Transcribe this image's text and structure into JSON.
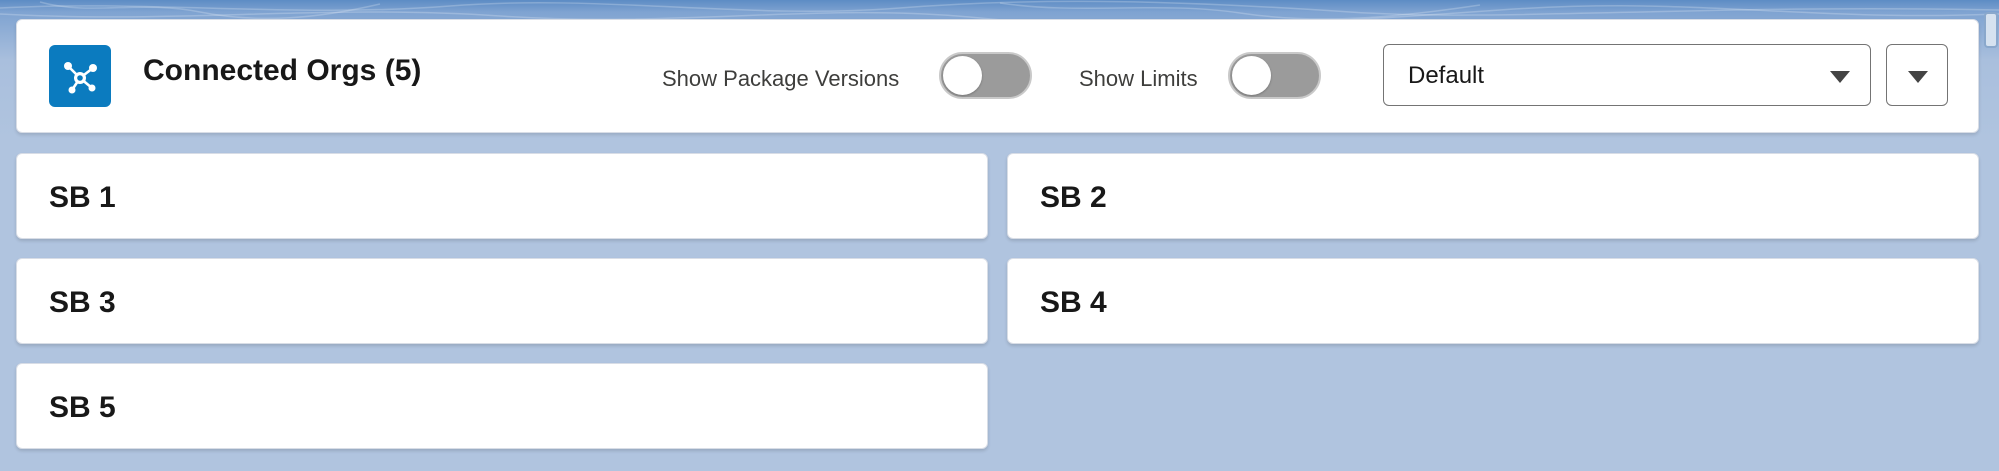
{
  "header": {
    "icon": "connected-orgs-icon",
    "title": "Connected Orgs (5)",
    "toggles": [
      {
        "label": "Show Package Versions",
        "on": false
      },
      {
        "label": "Show Limits",
        "on": false
      }
    ],
    "select": {
      "value": "Default"
    },
    "menu_icon": "chevron-down-icon"
  },
  "orgs": [
    {
      "name": "SB 1"
    },
    {
      "name": "SB 2"
    },
    {
      "name": "SB 3"
    },
    {
      "name": "SB 4"
    },
    {
      "name": "SB 5"
    }
  ],
  "colors": {
    "brand_icon": "#0b7bbf",
    "page_bg": "#b0c4df",
    "toggle_off": "#9b9b9b"
  }
}
